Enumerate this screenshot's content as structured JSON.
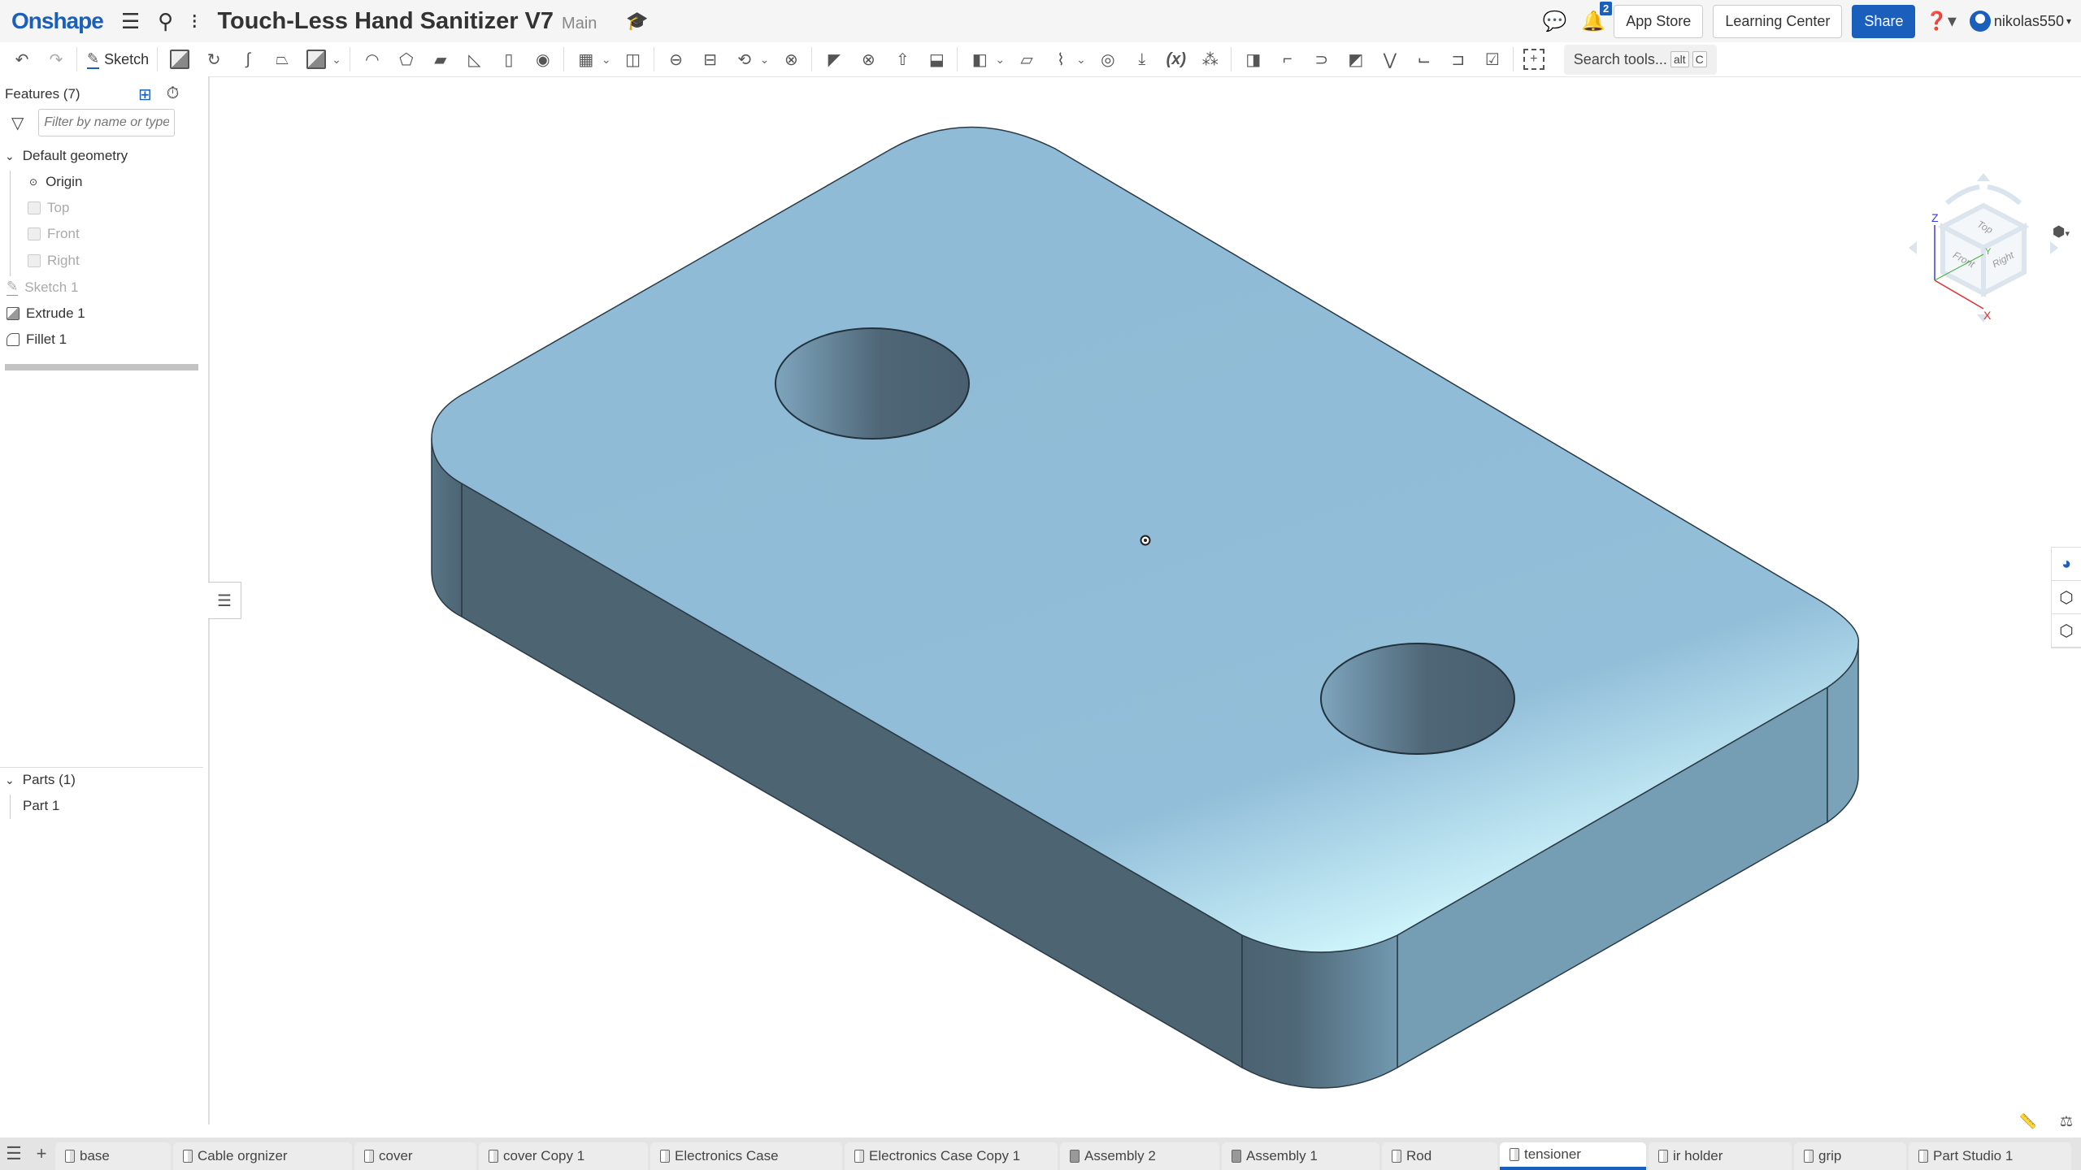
{
  "header": {
    "logo": "Onshape",
    "document_title": "Touch-Less Hand Sanitizer V7",
    "branch": "Main",
    "notifications_count": "2",
    "app_store_label": "App Store",
    "learning_center_label": "Learning Center",
    "share_label": "Share",
    "username": "nikolas550"
  },
  "toolbar": {
    "sketch_label": "Sketch",
    "search_placeholder": "Search tools...",
    "search_shortcut_1": "alt",
    "search_shortcut_2": "C",
    "tools": [
      "undo",
      "redo",
      "sketch",
      "extrude",
      "revolve",
      "sweep",
      "loft",
      "thicken",
      "fillet",
      "chamfer",
      "draft",
      "rib",
      "shell",
      "hole",
      "pattern",
      "mirror",
      "boolean",
      "split",
      "transform",
      "delete-part",
      "modify-fillet",
      "delete-face",
      "move-face",
      "replace-face",
      "offset-surface",
      "plane",
      "helix",
      "mate-connector",
      "import",
      "variable",
      "derived",
      "sheet-metal",
      "flange",
      "hem",
      "tab",
      "bend",
      "joint",
      "corner",
      "finish",
      "add-custom-feature"
    ]
  },
  "feature_panel": {
    "title": "Features (7)",
    "filter_placeholder": "Filter by name or type",
    "default_geometry_label": "Default geometry",
    "items": [
      {
        "label": "Origin",
        "dim": false
      },
      {
        "label": "Top",
        "dim": true
      },
      {
        "label": "Front",
        "dim": true
      },
      {
        "label": "Right",
        "dim": true
      }
    ],
    "features": [
      {
        "label": "Sketch 1",
        "dim": true
      },
      {
        "label": "Extrude 1",
        "dim": false
      },
      {
        "label": "Fillet 1",
        "dim": false
      }
    ],
    "parts_label": "Parts (1)",
    "parts": [
      "Part 1"
    ]
  },
  "viewcube": {
    "faces": [
      "Top",
      "Front",
      "Right"
    ],
    "axes": [
      "X",
      "Y",
      "Z"
    ]
  },
  "colors": {
    "accent": "#1b5fbd",
    "part_top": "#8fbbd6",
    "part_side_dark": "#4d6473",
    "part_side_light": "#759db3"
  },
  "tabs": [
    {
      "label": "base",
      "type": "partstudio",
      "active": false
    },
    {
      "label": "Cable orgnizer",
      "type": "partstudio",
      "active": false
    },
    {
      "label": "cover",
      "type": "partstudio",
      "active": false
    },
    {
      "label": "cover Copy 1",
      "type": "partstudio",
      "active": false
    },
    {
      "label": "Electronics Case",
      "type": "partstudio",
      "active": false
    },
    {
      "label": "Electronics Case Copy 1",
      "type": "partstudio",
      "active": false
    },
    {
      "label": "Assembly 2",
      "type": "assembly",
      "active": false
    },
    {
      "label": "Assembly 1",
      "type": "assembly",
      "active": false
    },
    {
      "label": "Rod",
      "type": "partstudio",
      "active": false
    },
    {
      "label": "tensioner",
      "type": "partstudio",
      "active": true
    },
    {
      "label": "ir holder",
      "type": "partstudio",
      "active": false
    },
    {
      "label": "grip",
      "type": "partstudio",
      "active": false
    },
    {
      "label": "Part Studio 1",
      "type": "partstudio",
      "active": false
    }
  ]
}
